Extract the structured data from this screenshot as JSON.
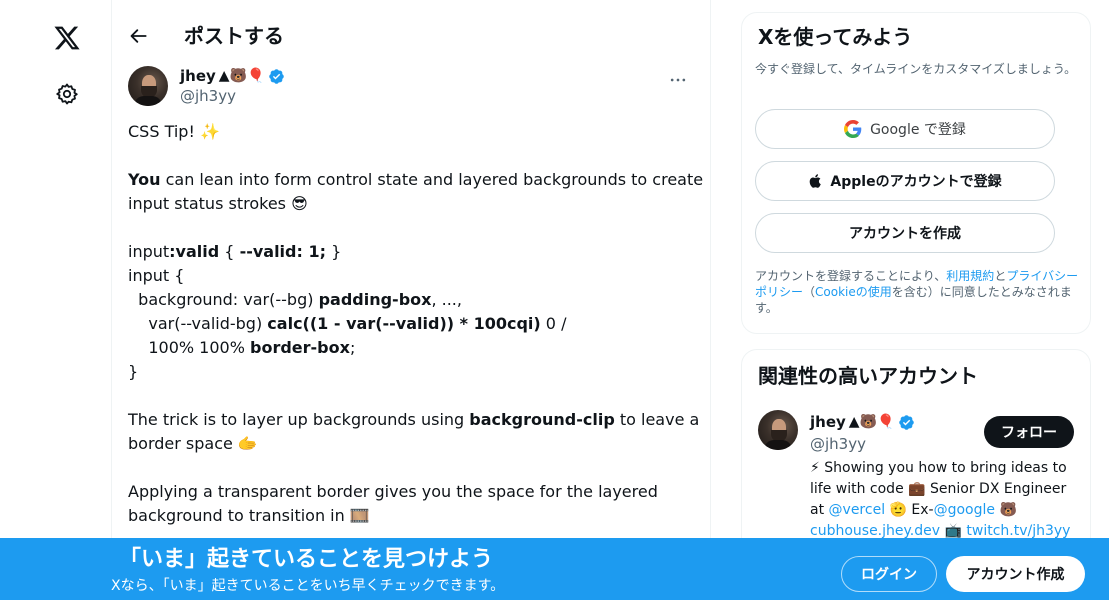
{
  "nav": {
    "logo_icon": "x-logo-icon",
    "settings_icon": "gear-icon"
  },
  "header": {
    "title": "ポストする"
  },
  "post": {
    "author_name": "jhey",
    "author_emoji": "▲🐻🎈",
    "handle": "@jh3yy",
    "lines": [
      "CSS Tip! ✨",
      "",
      "You can lean into form control state and layered backgrounds to create",
      "input status strokes 😎",
      "",
      "input:valid { --valid: 1; }",
      "input {",
      "  background: var(--bg) padding-box, ...,",
      "    var(--valid-bg) calc((1 - var(--valid)) * 100cqi) 0 /",
      "    100% 100% border-box;",
      "}",
      "",
      "The trick is to layer up backgrounds using background-clip to leave a",
      "border space 🫱",
      "",
      "Applying a transparent border gives you the space for the layered",
      "background to transition in 🎞️"
    ]
  },
  "signup": {
    "title": "Xを使ってみよう",
    "subtitle": "今すぐ登録して、タイムラインをカスタマイズしましょう。",
    "google_label": "Google で登録",
    "apple_label": "Appleのアカウントで登録",
    "create_label": "アカウントを作成",
    "legal_prefix": "アカウントを登録することにより、",
    "legal_terms": "利用規約",
    "legal_and": "と",
    "legal_privacy": "プライバシーポリシー",
    "legal_open": "（",
    "legal_cookie": "Cookieの使用",
    "legal_suffix": "を含む）に同意したとみなされます。"
  },
  "related": {
    "title": "関連性の高いアカウント",
    "name": "jhey",
    "emoji": "▲🐻🎈",
    "handle": "@jh3yy",
    "follow_label": "フォロー",
    "bio_1": "⚡ Showing you how to bring ideas to life with code 💼 Senior DX Engineer at ",
    "bio_vercel": "@vercel",
    "bio_2": " 🫡 Ex-",
    "bio_google": "@google",
    "bio_3": " 🐻 ",
    "bio_link1": "cubhouse.jhey.dev",
    "bio_4": " 📺 ",
    "bio_link2": "twitch.tv/jh3yy"
  },
  "banner": {
    "title": "「いま」起きていることを見つけよう",
    "subtitle": "Xなら、「いま」起きていることをいち早くチェックできます。",
    "login_label": "ログイン",
    "signup_label": "アカウント作成"
  },
  "colors": {
    "accent": "#1d9bf0",
    "text": "#0f1419",
    "muted": "#536471"
  }
}
